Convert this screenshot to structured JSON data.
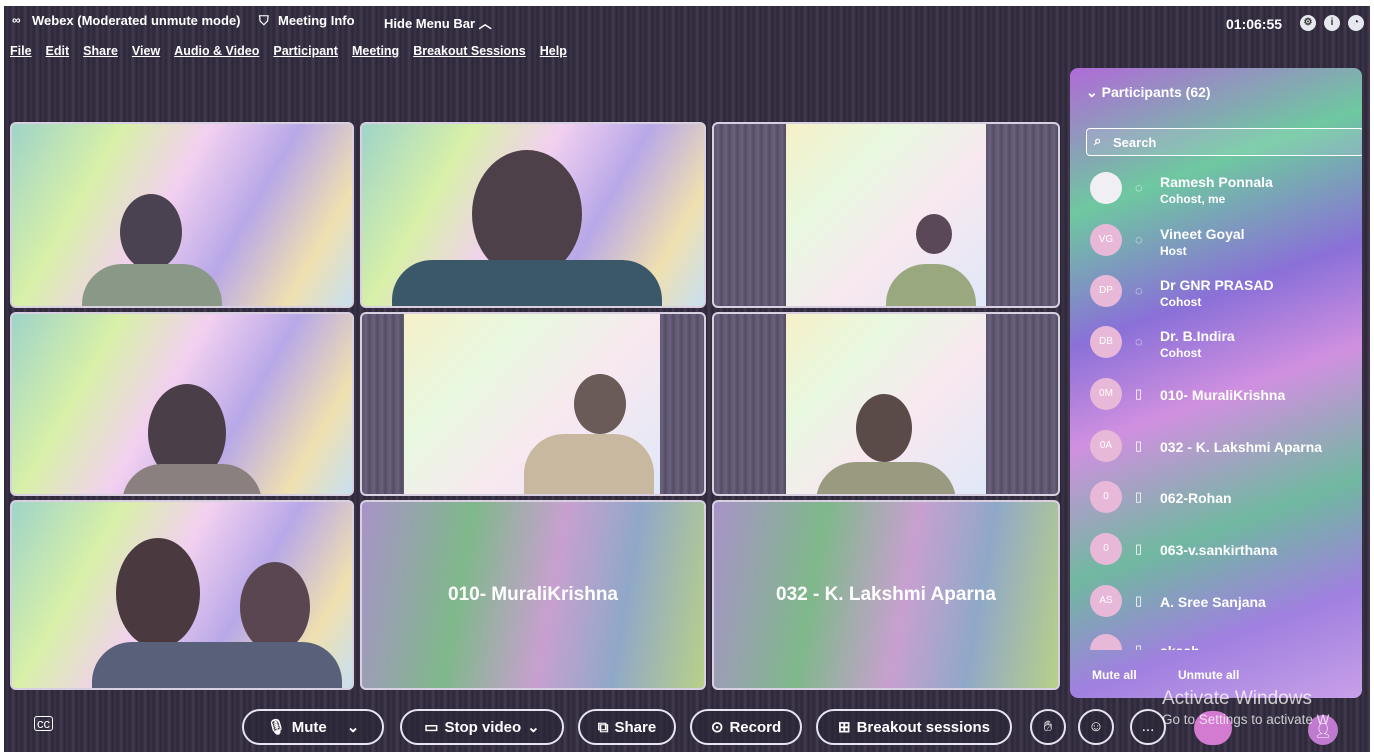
{
  "window": {
    "title": "Webex (Moderated unmute mode)",
    "meeting_info": "Meeting Info",
    "hide_menu": "Hide Menu Bar",
    "clock": "01:06:55"
  },
  "menu": [
    "File",
    "Edit",
    "Share",
    "View",
    "Audio & Video",
    "Participant",
    "Meeting",
    "Breakout Sessions",
    "Help"
  ],
  "tiles": {
    "name_tile_1": "010- MuraliKrishna",
    "name_tile_2": "032 - K. Lakshmi Aparna"
  },
  "participants": {
    "header": "Participants (62)",
    "search_placeholder": "Search",
    "list": [
      {
        "name": "Ramesh Ponnala",
        "role": "Cohost, me",
        "avatar": ""
      },
      {
        "name": "Vineet Goyal",
        "role": "Host",
        "avatar": "VG"
      },
      {
        "name": "Dr GNR PRASAD",
        "role": "Cohost",
        "avatar": "DP"
      },
      {
        "name": "Dr. B.Indira",
        "role": "Cohost",
        "avatar": "DB"
      },
      {
        "name": "010- MuraliKrishna",
        "role": "",
        "avatar": "0M"
      },
      {
        "name": "032 - K. Lakshmi Aparna",
        "role": "",
        "avatar": "0A"
      },
      {
        "name": "062-Rohan",
        "role": "",
        "avatar": "0"
      },
      {
        "name": "063-v.sankirthana",
        "role": "",
        "avatar": "0"
      },
      {
        "name": "A. Sree Sanjana",
        "role": "",
        "avatar": "AS"
      },
      {
        "name": "akash",
        "role": "",
        "avatar": ""
      }
    ],
    "mute_all": "Mute all",
    "unmute_all": "Unmute all"
  },
  "controls": {
    "mute": "Mute",
    "stop_video": "Stop video",
    "share": "Share",
    "record": "Record",
    "breakout": "Breakout sessions",
    "more": "..."
  },
  "watermark": {
    "line1": "Activate Windows",
    "line2": "Go to Settings to activate W"
  }
}
